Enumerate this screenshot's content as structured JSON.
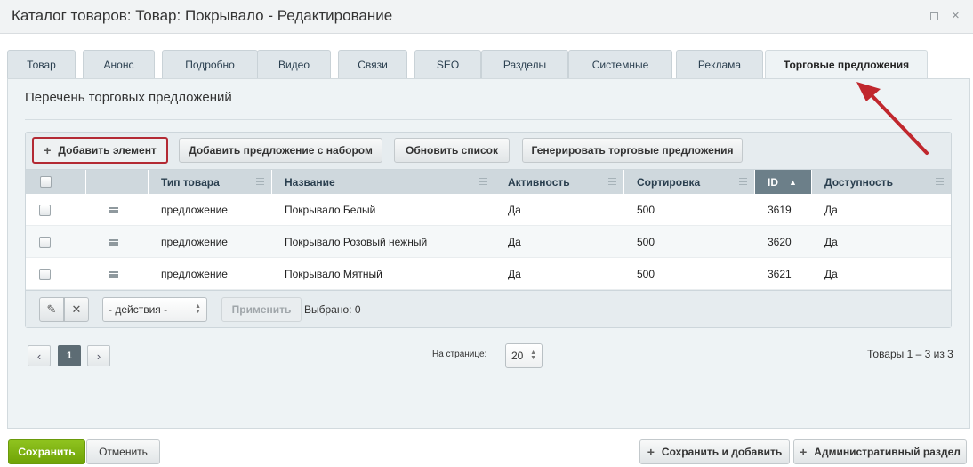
{
  "window": {
    "title": "Каталог товаров: Товар: Покрывало - Редактирование",
    "maximize_icon": "maximize-icon",
    "close_glyph": "×"
  },
  "tabs": [
    {
      "label": "Товар"
    },
    {
      "label": "Анонс"
    },
    {
      "label": "Подробно"
    },
    {
      "label": "Видео"
    },
    {
      "label": "Связи"
    },
    {
      "label": "SEO"
    },
    {
      "label": "Разделы"
    },
    {
      "label": "Системные"
    },
    {
      "label": "Реклама"
    },
    {
      "label": "Торговые предложения",
      "active": true
    }
  ],
  "section": {
    "title": "Перечень торговых предложений"
  },
  "toolbar": {
    "add_element": "Добавить элемент",
    "add_offer_set": "Добавить предложение с набором",
    "refresh_list": "Обновить список",
    "generate_offers": "Генерировать торговые предложения",
    "plus_glyph": "+"
  },
  "table": {
    "columns": [
      "Тип товара",
      "Название",
      "Активность",
      "Сортировка",
      "ID",
      "Доступность"
    ],
    "sorted_column": "ID",
    "sort_glyph": "▲",
    "rows": [
      {
        "type": "предложение",
        "name": "Покрывало Белый",
        "active": "Да",
        "sort": "500",
        "id": "3619",
        "available": "Да"
      },
      {
        "type": "предложение",
        "name": "Покрывало Розовый нежный",
        "active": "Да",
        "sort": "500",
        "id": "3620",
        "available": "Да"
      },
      {
        "type": "предложение",
        "name": "Покрывало Мятный",
        "active": "Да",
        "sort": "500",
        "id": "3621",
        "available": "Да"
      }
    ]
  },
  "footer": {
    "edit_glyph": "✎",
    "delete_glyph": "✕",
    "actions_select": "- действия -",
    "apply_button": "Применить",
    "selected_text": "Выбрано: 0"
  },
  "pager": {
    "prev_glyph": "‹",
    "current_page": "1",
    "next_glyph": "›",
    "per_page_label": "На странице:",
    "per_page_value": "20",
    "items_count": "Товары 1 – 3 из 3"
  },
  "bottom": {
    "save": "Сохранить",
    "cancel": "Отменить",
    "save_and_add": "Сохранить и добавить",
    "admin_section": "Административный раздел"
  },
  "colors": {
    "annotation_arrow": "#c0272d",
    "save_button": "#7bb30f",
    "highlight_border": "#b32a34"
  }
}
